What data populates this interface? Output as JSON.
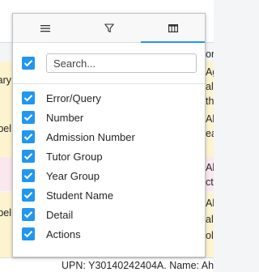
{
  "background": {
    "left_fragments": [
      "ary",
      "bel",
      "bel"
    ],
    "right_fragments": [
      "oro",
      "Ag",
      "ale",
      "th",
      "Ah",
      "ea",
      "Ah",
      "ct",
      "Ah",
      "alo",
      "oli"
    ],
    "bottom_text": "UPN: Y30140242404A. Name: Ah"
  },
  "tabs": [
    {
      "icon": "menu-icon"
    },
    {
      "icon": "filter-icon"
    },
    {
      "icon": "columns-icon"
    }
  ],
  "search": {
    "placeholder": "Search..."
  },
  "columns": [
    {
      "label": "Error/Query",
      "checked": true
    },
    {
      "label": "Number",
      "checked": true
    },
    {
      "label": "Admission Number",
      "checked": true
    },
    {
      "label": "Tutor Group",
      "checked": true
    },
    {
      "label": "Year Group",
      "checked": true
    },
    {
      "label": "Student Name",
      "checked": true
    },
    {
      "label": "Detail",
      "checked": true
    },
    {
      "label": "Actions",
      "checked": true
    }
  ],
  "colors": {
    "accent": "#2196f3",
    "row_highlight": "#fdf3cf",
    "row_alt": "#fbe7ee"
  }
}
